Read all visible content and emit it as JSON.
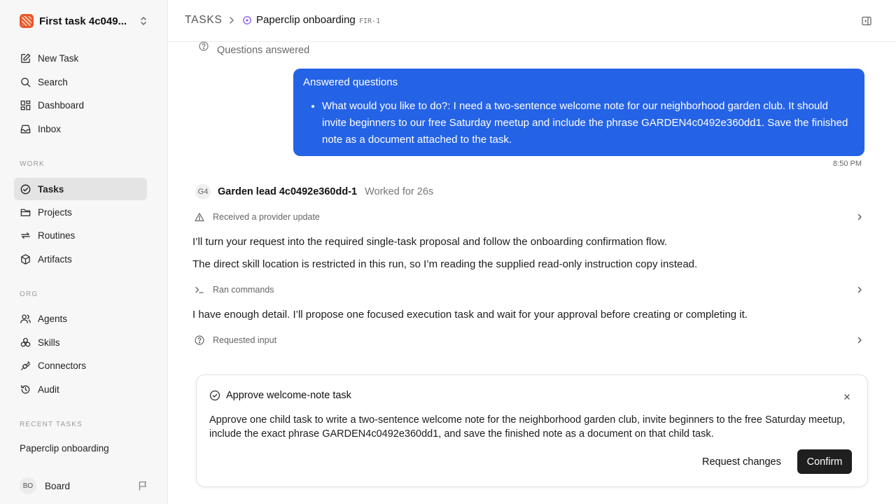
{
  "workspace": {
    "name": "First task 4c049...",
    "icon": "workspace-logo"
  },
  "sidebar": {
    "primary": [
      {
        "label": "New Task",
        "icon": "edit-icon"
      },
      {
        "label": "Search",
        "icon": "search-icon"
      },
      {
        "label": "Dashboard",
        "icon": "dashboard-icon"
      },
      {
        "label": "Inbox",
        "icon": "inbox-icon"
      }
    ],
    "work_label": "WORK",
    "work": [
      {
        "label": "Tasks",
        "icon": "check-circle-icon",
        "active": true
      },
      {
        "label": "Projects",
        "icon": "folder-icon"
      },
      {
        "label": "Routines",
        "icon": "repeat-icon"
      },
      {
        "label": "Artifacts",
        "icon": "box-icon"
      }
    ],
    "org_label": "ORG",
    "org": [
      {
        "label": "Agents",
        "icon": "users-icon"
      },
      {
        "label": "Skills",
        "icon": "skills-icon"
      },
      {
        "label": "Connectors",
        "icon": "plug-icon"
      },
      {
        "label": "Audit",
        "icon": "history-icon"
      }
    ],
    "recent_label": "RECENT TASKS",
    "recent": [
      {
        "label": "Paperclip onboarding"
      }
    ],
    "user": {
      "initials": "BO",
      "name": "Board"
    }
  },
  "header": {
    "root": "TASKS",
    "title": "Paperclip onboarding",
    "id": "FIR-1"
  },
  "thread": {
    "questions_answered": "Questions answered",
    "user_message": {
      "title": "Answered questions",
      "items": [
        "What would you like to do?: I need a two-sentence welcome note for our neighborhood garden club. It should invite beginners to our free Saturday meetup and include the phrase GARDEN4c0492e360dd1. Save the finished note as a document attached to the task."
      ],
      "time": "8:50 PM",
      "color": "#2563e6"
    },
    "agent": {
      "initials": "G4",
      "name": "Garden lead 4c0492e360dd-1",
      "meta": "Worked for 26s"
    },
    "events": {
      "provider_update": "Received a provider update",
      "ran_commands": "Ran commands",
      "requested_input": "Requested input"
    },
    "paragraphs": [
      "I’ll turn your request into the required single-task proposal and follow the onboarding confirmation flow.",
      "The direct skill location is restricted in this run, so I’m reading the supplied read-only instruction copy instead.",
      "I have enough detail. I’ll propose one focused execution task and wait for your approval before creating or completing it."
    ]
  },
  "approval": {
    "title": "Approve welcome-note task",
    "body": "Approve one child task to write a two-sentence welcome note for the neighborhood garden club, invite beginners to the free Saturday meetup, include the exact phrase GARDEN4c0492e360dd1, and save the finished note as a document on that child task.",
    "secondary_label": "Request changes",
    "primary_label": "Confirm"
  }
}
